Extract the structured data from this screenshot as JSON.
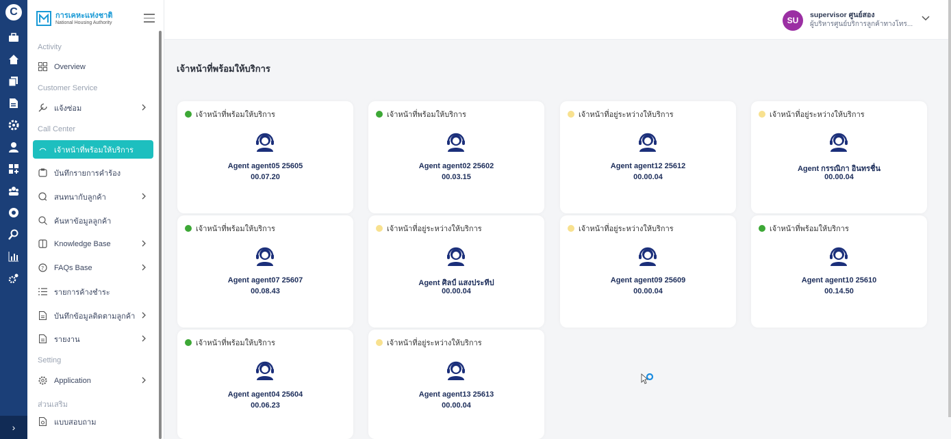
{
  "colors": {
    "accent": "#1dbfbf",
    "rail": "#1b3f78",
    "available": "#3da836",
    "busy": "#f8e18f",
    "avatar": "#9b2fa3"
  },
  "rail": {
    "icons": [
      "logo-icon",
      "briefcase-icon",
      "home-icon",
      "copy-icon",
      "document-icon",
      "gear-icon",
      "user-icon",
      "apps-icon",
      "group-icon",
      "settings-icon",
      "search-icon",
      "chart-icon",
      "cogs-icon"
    ],
    "expand": "›"
  },
  "brand": {
    "th": "การเคหะแห่งชาติ",
    "en": "National Housing Authority"
  },
  "sidebar": {
    "sections": {
      "activity": "Activity",
      "customer_service": "Customer Service",
      "call_center": "Call Center",
      "setting": "Setting",
      "extra": "ส่วนเสริม"
    },
    "items": [
      {
        "label": "Overview",
        "icon": "grid-icon",
        "chevron": false
      },
      {
        "label": "แจ้งซ่อม",
        "icon": "wrench-icon",
        "chevron": true
      },
      {
        "label": "เจ้าหน้าที่พร้อมให้บริการ",
        "icon": "headset-icon",
        "chevron": false,
        "active": true
      },
      {
        "label": "บันทึกรายการคำร้อง",
        "icon": "clipboard-icon",
        "chevron": false
      },
      {
        "label": "สนทนากับลูกค้า",
        "icon": "chat-icon",
        "chevron": true
      },
      {
        "label": "ค้นหาข้อมูลลูกค้า",
        "icon": "search-icon",
        "chevron": false
      },
      {
        "label": "Knowledge Base",
        "icon": "book-icon",
        "chevron": true
      },
      {
        "label": "FAQs Base",
        "icon": "question-icon",
        "chevron": true
      },
      {
        "label": "รายการค้างชำระ",
        "icon": "list-icon",
        "chevron": false
      },
      {
        "label": "บันทึกข้อมูลติดตามลูกค้า",
        "icon": "document-icon",
        "chevron": true
      },
      {
        "label": "รายงาน",
        "icon": "report-icon",
        "chevron": true
      },
      {
        "label": "Application",
        "icon": "gear-icon",
        "chevron": true
      },
      {
        "label": "แบบสอบถาม",
        "icon": "survey-icon",
        "chevron": false
      }
    ]
  },
  "user": {
    "initials": "SU",
    "name": "supervisor ศูนย์สอง",
    "role": "ผู้บริหารศูนย์บริการลูกค้าทางโทร..."
  },
  "main": {
    "title": "เจ้าหน้าที่พร้อมให้บริการ",
    "cards": [
      {
        "status": "เจ้าหน้าที่พร้อมให้บริการ",
        "state": "available",
        "agent": "Agent agent05 25605",
        "time": "00.07.20"
      },
      {
        "status": "เจ้าหน้าที่พร้อมให้บริการ",
        "state": "available",
        "agent": "Agent agent02 25602",
        "time": "00.03.15"
      },
      {
        "status": "เจ้าหน้าที่อยู่ระหว่างให้บริการ",
        "state": "busy",
        "agent": "Agent agent12 25612",
        "time": "00.00.04"
      },
      {
        "status": "เจ้าหน้าที่อยู่ระหว่างให้บริการ",
        "state": "busy",
        "agent": "Agent กรรณิกา อินทรชื่น",
        "time": "00.00.04"
      },
      {
        "status": "เจ้าหน้าที่พร้อมให้บริการ",
        "state": "available",
        "agent": "Agent agent07 25607",
        "time": "00.08.43"
      },
      {
        "status": "เจ้าหน้าที่อยู่ระหว่างให้บริการ",
        "state": "busy",
        "agent": "Agent ศิลป์ แสงประทีป",
        "time": "00.00.04"
      },
      {
        "status": "เจ้าหน้าที่อยู่ระหว่างให้บริการ",
        "state": "busy",
        "agent": "Agent agent09 25609",
        "time": "00.00.04"
      },
      {
        "status": "เจ้าหน้าที่พร้อมให้บริการ",
        "state": "available",
        "agent": "Agent agent10 25610",
        "time": "00.14.50"
      },
      {
        "status": "เจ้าหน้าที่พร้อมให้บริการ",
        "state": "available",
        "agent": "Agent agent04 25604",
        "time": "00.06.23"
      },
      {
        "status": "เจ้าหน้าที่อยู่ระหว่างให้บริการ",
        "state": "busy",
        "agent": "Agent agent13 25613",
        "time": "00.00.04"
      }
    ]
  }
}
